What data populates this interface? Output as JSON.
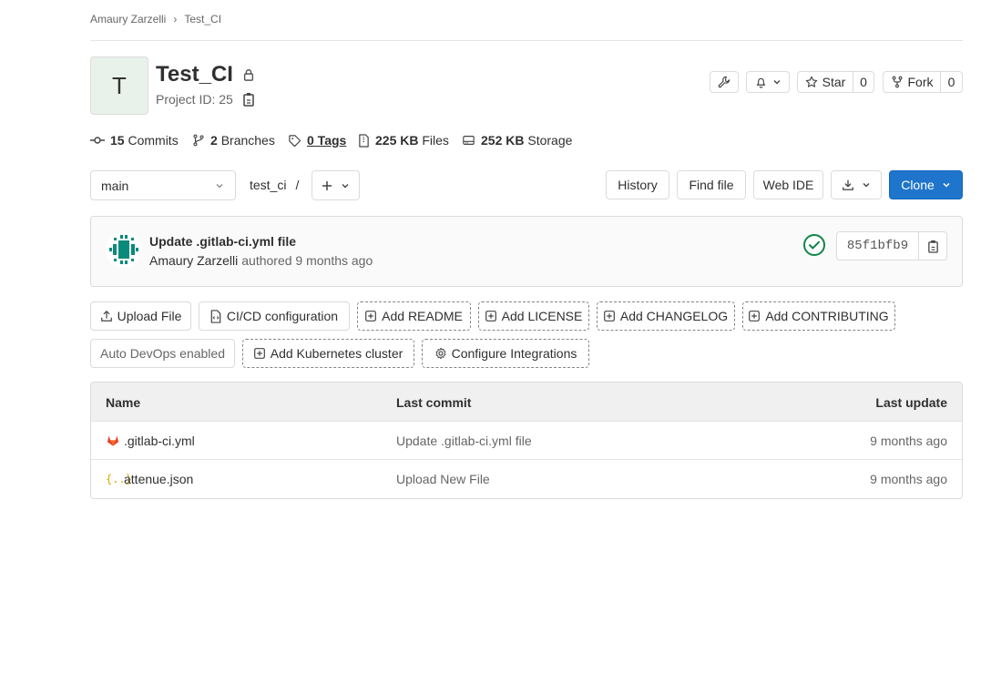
{
  "breadcrumb": {
    "owner": "Amaury Zarzelli",
    "separator": "›",
    "project": "Test_CI"
  },
  "project": {
    "avatar_letter": "T",
    "title": "Test_CI",
    "id_label": "Project ID: 25"
  },
  "actions": {
    "star_label": "Star",
    "star_count": "0",
    "fork_label": "Fork",
    "fork_count": "0"
  },
  "stats": {
    "commits_count": "15",
    "commits_label": "Commits",
    "branches_count": "2",
    "branches_label": "Branches",
    "tags_label": "0 Tags",
    "files_size": "225 KB",
    "files_label": "Files",
    "storage_size": "252 KB",
    "storage_label": "Storage"
  },
  "toolbar": {
    "branch": "main",
    "path": "test_ci",
    "path_sep": "/",
    "history": "History",
    "find_file": "Find file",
    "web_ide": "Web IDE",
    "clone": "Clone"
  },
  "commit": {
    "message": "Update .gitlab-ci.yml file",
    "author": "Amaury Zarzelli",
    "meta": "authored 9 months ago",
    "sha": "85f1bfb9",
    "status_color": "#108548"
  },
  "quick_actions": {
    "upload_file": "Upload File",
    "cicd_config": "CI/CD configuration",
    "add_readme": "Add README",
    "add_license": "Add LICENSE",
    "add_changelog": "Add CHANGELOG",
    "add_contributing": "Add CONTRIBUTING",
    "auto_devops": "Auto DevOps enabled",
    "add_k8s": "Add Kubernetes cluster",
    "configure_integrations": "Configure Integrations"
  },
  "table": {
    "headers": {
      "name": "Name",
      "last_commit": "Last commit",
      "last_update": "Last update"
    },
    "rows": [
      {
        "name": ".gitlab-ci.yml",
        "icon": "gitlab-icon",
        "commit": "Update .gitlab-ci.yml file",
        "updated": "9 months ago"
      },
      {
        "name": "attenue.json",
        "icon": "json-icon",
        "commit": "Upload New File",
        "updated": "9 months ago"
      }
    ]
  },
  "colors": {
    "accent": "#1f75cb",
    "success": "#108548",
    "gitlab_orange": "#e24329",
    "json_yellow": "#e0a800",
    "avatar_teal": "#0a8a7a"
  }
}
